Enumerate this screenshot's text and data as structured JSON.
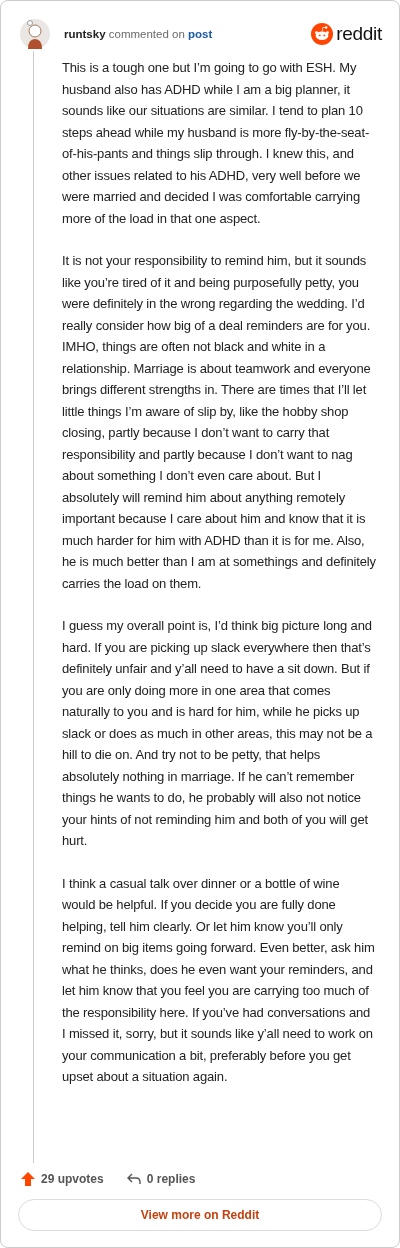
{
  "header": {
    "username": "runtsky",
    "action": "commented on",
    "link": "post",
    "brand": "reddit"
  },
  "paragraphs": [
    "This is a tough one but I’m going to go with ESH. My husband also has ADHD while I am a big planner, it sounds like our situations are similar. I tend to plan 10 steps ahead while my husband is more fly-by-the-seat-of-his-pants and things slip through. I knew this, and other issues related to his ADHD, very well before we were married and decided I was comfortable carrying more of the load in that one aspect.",
    "It is not your responsibility to remind him, but it sounds like you’re tired of it and being purposefully petty, you were definitely in the wrong regarding the wedding. I’d really consider how big of a deal reminders are for you. IMHO, things are often not black and white in a relationship. Marriage is about teamwork and everyone brings different strengths in. There are times that I’ll let little things I’m aware of slip by, like the hobby shop closing, partly because I don’t want to carry that responsibility and partly because I don’t want to nag about something I don’t even care about. But I absolutely will remind him about anything remotely important because I care about him and know that it is much harder for him with ADHD than it is for me. Also, he is much better than I am at somethings and definitely carries the load on them.",
    "I guess my overall point is, I’d think big picture long and hard. If you are picking up slack everywhere then that’s definitely unfair and y’all need to have a sit down. But if you are only doing more in one area that comes naturally to you and is hard for him, while he picks up slack or does as much in other areas, this may not be a hill to die on. And try not to be petty, that helps absolutely nothing in marriage. If he can’t remember things he wants to do, he probably will also not notice your hints of not reminding him and both of you will get hurt.",
    "I think a casual talk over dinner or a bottle of wine would be helpful. If you decide you are fully done helping, tell him clearly. Or let him know you’ll only remind on big items going forward. Even better, ask him what he thinks, does he even want your reminders, and let him know that you feel you are carrying too much of the responsibility here. If you’ve had conversations and I missed it, sorry, but it sounds like y’all need to work on your communication a bit, preferably before you get upset about a situation again."
  ],
  "footer": {
    "upvotes": "29 upvotes",
    "replies": "0 replies",
    "button": "View more on Reddit"
  }
}
